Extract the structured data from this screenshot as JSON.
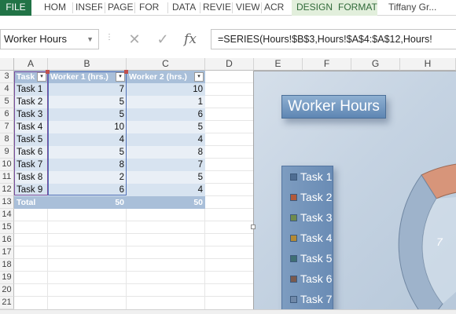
{
  "ribbon": {
    "tabs": [
      "FILE",
      "HOM",
      "INSER",
      "PAGE",
      "FOR",
      "DATA",
      "REVIE",
      "VIEW",
      "ACR",
      "DESIGN",
      "FORMAT"
    ],
    "user": "Tiffany Gr..."
  },
  "formula_bar": {
    "name_box": "Worker Hours",
    "cancel_symbol": "✕",
    "enter_symbol": "✓",
    "fx_label": "fx",
    "formula": "=SERIES(Hours!$B$3,Hours!$A$4:$A$12,Hours!"
  },
  "columns": [
    "A",
    "B",
    "C",
    "D",
    "E",
    "F",
    "G",
    "H"
  ],
  "rows": [
    "3",
    "4",
    "5",
    "6",
    "7",
    "8",
    "9",
    "10",
    "11",
    "12",
    "13",
    "14",
    "15",
    "16",
    "17",
    "18",
    "19",
    "20",
    "21"
  ],
  "table": {
    "headers": [
      "Task",
      "Worker 1 (hrs.)",
      "Worker 2 (hrs.)"
    ],
    "dropdown_symbol": "▾",
    "data": [
      [
        "Task 1",
        "7",
        "10"
      ],
      [
        "Task 2",
        "5",
        "1"
      ],
      [
        "Task 3",
        "5",
        "6"
      ],
      [
        "Task 4",
        "10",
        "5"
      ],
      [
        "Task 5",
        "4",
        "4"
      ],
      [
        "Task 6",
        "5",
        "8"
      ],
      [
        "Task 7",
        "8",
        "7"
      ],
      [
        "Task 8",
        "2",
        "5"
      ],
      [
        "Task 9",
        "6",
        "4"
      ]
    ],
    "total": [
      "Total",
      "50",
      "50"
    ]
  },
  "chart": {
    "title": "Worker Hours",
    "legend": [
      {
        "label": "Task 1",
        "color": "#4f6d92"
      },
      {
        "label": "Task 2",
        "color": "#b25a3a"
      },
      {
        "label": "Task 3",
        "color": "#6f8a4d"
      },
      {
        "label": "Task 4",
        "color": "#b38a35"
      },
      {
        "label": "Task 5",
        "color": "#3f6f73"
      },
      {
        "label": "Task 6",
        "color": "#7a5a4e"
      },
      {
        "label": "Task 7",
        "color": "#6f88a8"
      }
    ],
    "slice_label": "7"
  },
  "colors": {
    "excel_green": "#217346",
    "table_header": "#a9bfd9",
    "chart_bg": "#c5d3e2"
  }
}
